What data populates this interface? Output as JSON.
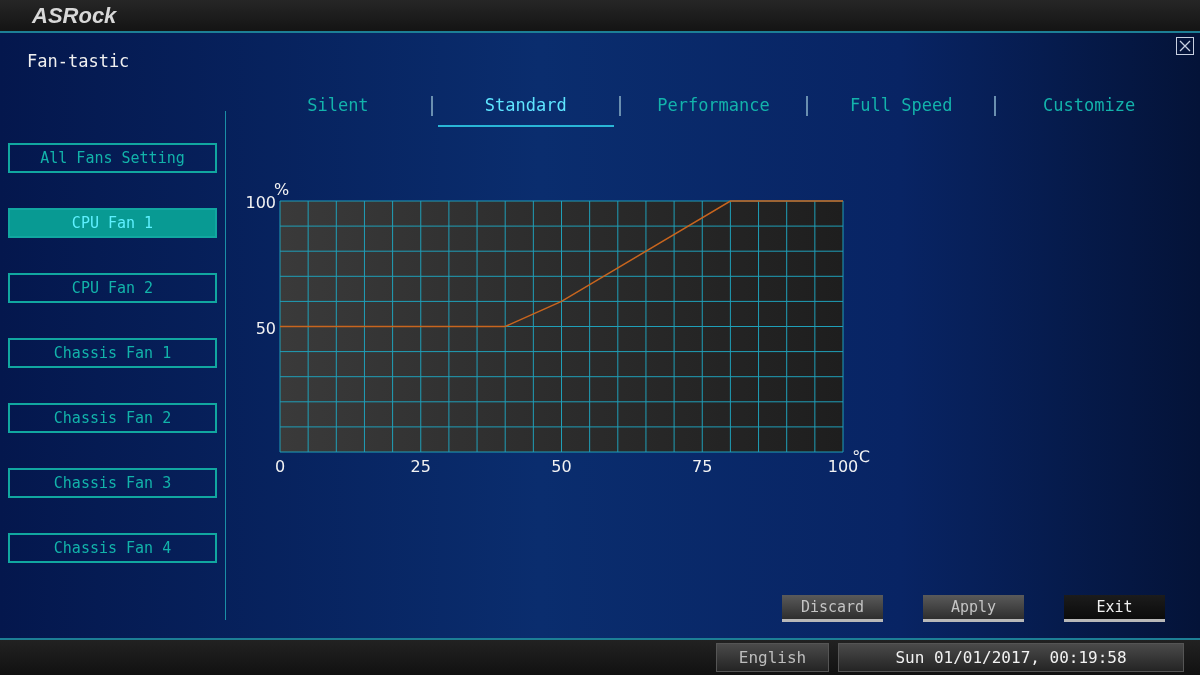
{
  "header": {
    "logo": "ASRock"
  },
  "window": {
    "title": "Fan-tastic"
  },
  "tabs": [
    {
      "label": "Silent",
      "selected": false
    },
    {
      "label": "Standard",
      "selected": true
    },
    {
      "label": "Performance",
      "selected": false
    },
    {
      "label": "Full Speed",
      "selected": false
    },
    {
      "label": "Customize",
      "selected": false
    }
  ],
  "sidebar": {
    "items": [
      {
        "label": "All Fans Setting",
        "selected": false
      },
      {
        "label": "CPU Fan 1",
        "selected": true
      },
      {
        "label": "CPU Fan 2",
        "selected": false
      },
      {
        "label": "Chassis Fan 1",
        "selected": false
      },
      {
        "label": "Chassis Fan 2",
        "selected": false
      },
      {
        "label": "Chassis Fan 3",
        "selected": false
      },
      {
        "label": "Chassis Fan 4",
        "selected": false
      }
    ]
  },
  "chart": {
    "chart_data": {
      "type": "line",
      "xlabel": "℃",
      "ylabel": "%",
      "x": [
        0,
        40,
        50,
        80,
        100
      ],
      "series": [
        {
          "color": "#c8651e",
          "values": [
            50,
            50,
            60,
            100,
            100
          ]
        }
      ],
      "xlim": [
        0,
        100
      ],
      "ylim": [
        0,
        100
      ],
      "xticks": [
        0,
        25,
        50,
        75,
        100
      ],
      "yticks": [
        50,
        100
      ],
      "grid": true
    }
  },
  "buttons": [
    {
      "label": "Discard",
      "disabled": true
    },
    {
      "label": "Apply",
      "disabled": true
    },
    {
      "label": "Exit",
      "disabled": false
    }
  ],
  "status_bar": {
    "language": "English",
    "datetime": "Sun 01/01/2017, 00:19:58"
  }
}
